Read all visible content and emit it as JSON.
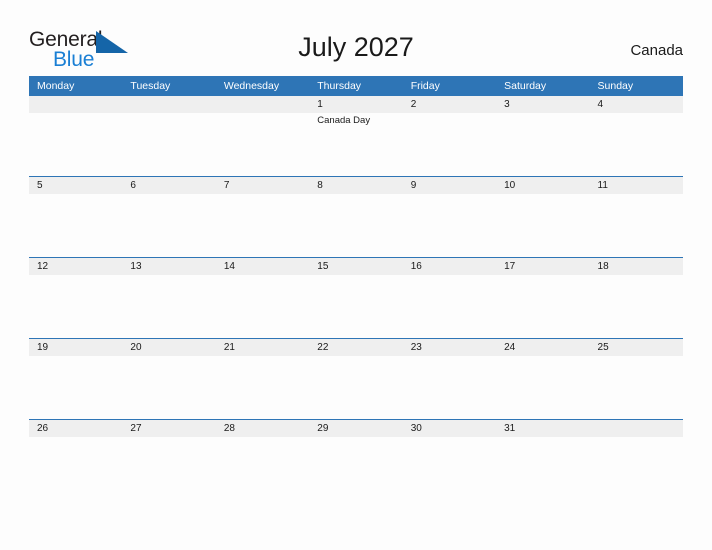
{
  "brand": {
    "name_part1": "General",
    "name_part2": "Blue",
    "flag_icon": "flag-triangle-icon",
    "color_text": "#231f20",
    "color_blue": "#1a7fd4"
  },
  "header": {
    "title": "July 2027",
    "country": "Canada"
  },
  "theme": {
    "header_blue": "#2e75b6",
    "day_band_gray": "#efefef",
    "page_background": "#fdfdfd",
    "text_color": "#1a1a1a"
  },
  "calendar": {
    "weekday_headers": [
      "Monday",
      "Tuesday",
      "Wednesday",
      "Thursday",
      "Friday",
      "Saturday",
      "Sunday"
    ],
    "weeks": [
      [
        {
          "day": "",
          "events": []
        },
        {
          "day": "",
          "events": []
        },
        {
          "day": "",
          "events": []
        },
        {
          "day": "1",
          "events": [
            "Canada Day"
          ]
        },
        {
          "day": "2",
          "events": []
        },
        {
          "day": "3",
          "events": []
        },
        {
          "day": "4",
          "events": []
        }
      ],
      [
        {
          "day": "5",
          "events": []
        },
        {
          "day": "6",
          "events": []
        },
        {
          "day": "7",
          "events": []
        },
        {
          "day": "8",
          "events": []
        },
        {
          "day": "9",
          "events": []
        },
        {
          "day": "10",
          "events": []
        },
        {
          "day": "11",
          "events": []
        }
      ],
      [
        {
          "day": "12",
          "events": []
        },
        {
          "day": "13",
          "events": []
        },
        {
          "day": "14",
          "events": []
        },
        {
          "day": "15",
          "events": []
        },
        {
          "day": "16",
          "events": []
        },
        {
          "day": "17",
          "events": []
        },
        {
          "day": "18",
          "events": []
        }
      ],
      [
        {
          "day": "19",
          "events": []
        },
        {
          "day": "20",
          "events": []
        },
        {
          "day": "21",
          "events": []
        },
        {
          "day": "22",
          "events": []
        },
        {
          "day": "23",
          "events": []
        },
        {
          "day": "24",
          "events": []
        },
        {
          "day": "25",
          "events": []
        }
      ],
      [
        {
          "day": "26",
          "events": []
        },
        {
          "day": "27",
          "events": []
        },
        {
          "day": "28",
          "events": []
        },
        {
          "day": "29",
          "events": []
        },
        {
          "day": "30",
          "events": []
        },
        {
          "day": "31",
          "events": []
        },
        {
          "day": "",
          "events": []
        }
      ]
    ]
  }
}
